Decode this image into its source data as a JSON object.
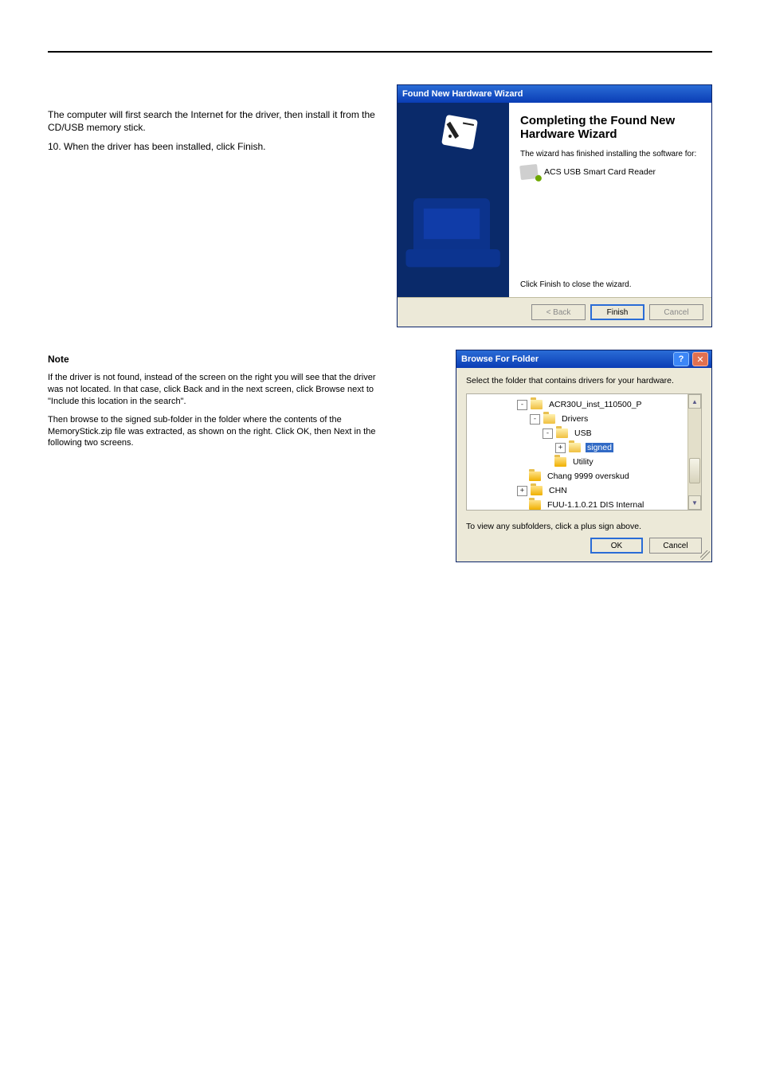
{
  "doc": {
    "step10_intro": "The computer will first search the Internet for the driver, then install it from the CD/USB memory stick.",
    "step10_num": "10.",
    "step10_text": "When the driver has been installed, click Finish.",
    "wizard": {
      "titlebar": "Found New Hardware Wizard",
      "heading": "Completing the Found New Hardware Wizard",
      "sub": "The wizard has finished installing the software for:",
      "device": "ACS USB Smart Card Reader",
      "closeline": "Click Finish to close the wizard.",
      "back": "< Back",
      "finish": "Finish",
      "cancel": "Cancel"
    },
    "note_title": "Note",
    "note_body": "If the driver is not found, instead of the screen on the right you will see that the driver was not located. In that case, click Back and in the next screen, click Browse next to \"Include this location in the search\".",
    "note_body2": "Then browse to the signed sub-folder in the folder where the contents of the MemoryStick.zip file was extracted, as shown on the right. Click OK, then Next in the following two screens.",
    "browse": {
      "title": "Browse For Folder",
      "msg": "Select the folder that contains drivers for your hardware.",
      "hint": "To view any subfolders, click a plus sign above.",
      "ok": "OK",
      "cancel": "Cancel",
      "tree": [
        {
          "indent": 0,
          "exp": "-",
          "open": true,
          "label": "ACR30U_inst_110500_P",
          "sel": false
        },
        {
          "indent": 1,
          "exp": "-",
          "open": true,
          "label": "Drivers",
          "sel": false
        },
        {
          "indent": 2,
          "exp": "-",
          "open": true,
          "label": "USB",
          "sel": false
        },
        {
          "indent": 3,
          "exp": "+",
          "open": true,
          "label": "signed",
          "sel": true
        },
        {
          "indent": 2,
          "exp": "",
          "open": false,
          "label": "Utility",
          "sel": false
        },
        {
          "indent": 0,
          "exp": "",
          "open": false,
          "label": "Chang 9999 overskud",
          "sel": false
        },
        {
          "indent": 0,
          "exp": "+",
          "open": false,
          "label": "CHN",
          "sel": false
        },
        {
          "indent": 0,
          "exp": "",
          "open": false,
          "label": "FUU-1.1.0.21 DIS Internal",
          "sel": false
        }
      ]
    }
  }
}
